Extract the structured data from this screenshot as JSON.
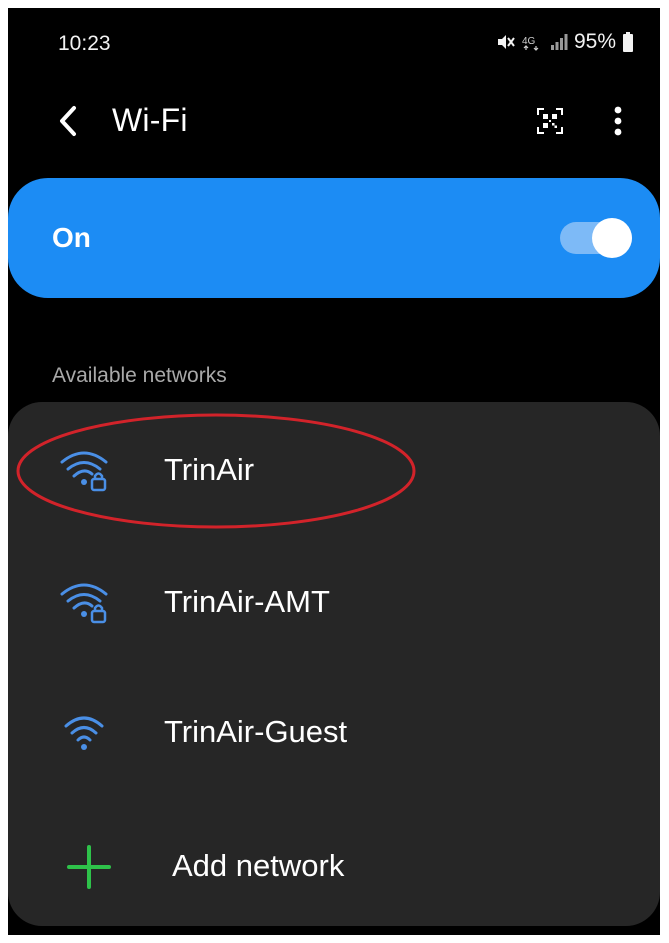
{
  "status_bar": {
    "time": "10:23",
    "battery": "95%"
  },
  "app_bar": {
    "title": "Wi-Fi",
    "back_icon": "chevron-left-icon",
    "qr_icon": "qr-scan-icon",
    "more_icon": "more-vert-icon"
  },
  "wifi_toggle": {
    "label": "On",
    "state": true,
    "accent": "#1c8cf4"
  },
  "available": {
    "header": "Available networks",
    "networks": [
      {
        "name": "TrinAir",
        "secured": true,
        "highlighted": true
      },
      {
        "name": "TrinAir-AMT",
        "secured": true,
        "highlighted": false
      },
      {
        "name": "TrinAir-Guest",
        "secured": false,
        "highlighted": false
      }
    ],
    "add_label": "Add network"
  },
  "colors": {
    "background": "#000000",
    "card": "#262626",
    "wifi_icon": "#4a8fe6",
    "add_icon": "#2ec24a",
    "annotation": "#d2232a"
  }
}
